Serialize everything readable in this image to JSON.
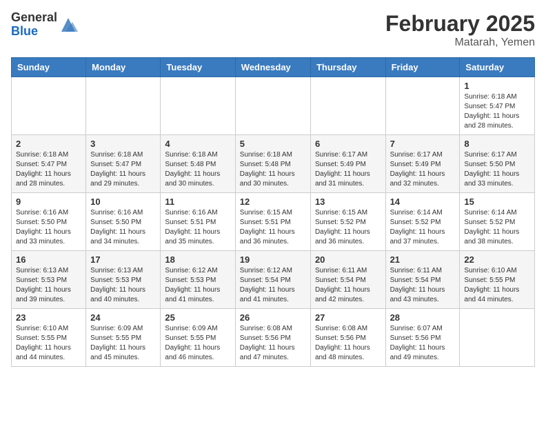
{
  "header": {
    "logo_general": "General",
    "logo_blue": "Blue",
    "month_title": "February 2025",
    "location": "Matarah, Yemen"
  },
  "days_of_week": [
    "Sunday",
    "Monday",
    "Tuesday",
    "Wednesday",
    "Thursday",
    "Friday",
    "Saturday"
  ],
  "weeks": [
    [
      {
        "day": "",
        "info": ""
      },
      {
        "day": "",
        "info": ""
      },
      {
        "day": "",
        "info": ""
      },
      {
        "day": "",
        "info": ""
      },
      {
        "day": "",
        "info": ""
      },
      {
        "day": "",
        "info": ""
      },
      {
        "day": "1",
        "info": "Sunrise: 6:18 AM\nSunset: 5:47 PM\nDaylight: 11 hours and 28 minutes."
      }
    ],
    [
      {
        "day": "2",
        "info": "Sunrise: 6:18 AM\nSunset: 5:47 PM\nDaylight: 11 hours and 28 minutes."
      },
      {
        "day": "3",
        "info": "Sunrise: 6:18 AM\nSunset: 5:47 PM\nDaylight: 11 hours and 29 minutes."
      },
      {
        "day": "4",
        "info": "Sunrise: 6:18 AM\nSunset: 5:48 PM\nDaylight: 11 hours and 30 minutes."
      },
      {
        "day": "5",
        "info": "Sunrise: 6:18 AM\nSunset: 5:48 PM\nDaylight: 11 hours and 30 minutes."
      },
      {
        "day": "6",
        "info": "Sunrise: 6:17 AM\nSunset: 5:49 PM\nDaylight: 11 hours and 31 minutes."
      },
      {
        "day": "7",
        "info": "Sunrise: 6:17 AM\nSunset: 5:49 PM\nDaylight: 11 hours and 32 minutes."
      },
      {
        "day": "8",
        "info": "Sunrise: 6:17 AM\nSunset: 5:50 PM\nDaylight: 11 hours and 33 minutes."
      }
    ],
    [
      {
        "day": "9",
        "info": "Sunrise: 6:16 AM\nSunset: 5:50 PM\nDaylight: 11 hours and 33 minutes."
      },
      {
        "day": "10",
        "info": "Sunrise: 6:16 AM\nSunset: 5:50 PM\nDaylight: 11 hours and 34 minutes."
      },
      {
        "day": "11",
        "info": "Sunrise: 6:16 AM\nSunset: 5:51 PM\nDaylight: 11 hours and 35 minutes."
      },
      {
        "day": "12",
        "info": "Sunrise: 6:15 AM\nSunset: 5:51 PM\nDaylight: 11 hours and 36 minutes."
      },
      {
        "day": "13",
        "info": "Sunrise: 6:15 AM\nSunset: 5:52 PM\nDaylight: 11 hours and 36 minutes."
      },
      {
        "day": "14",
        "info": "Sunrise: 6:14 AM\nSunset: 5:52 PM\nDaylight: 11 hours and 37 minutes."
      },
      {
        "day": "15",
        "info": "Sunrise: 6:14 AM\nSunset: 5:52 PM\nDaylight: 11 hours and 38 minutes."
      }
    ],
    [
      {
        "day": "16",
        "info": "Sunrise: 6:13 AM\nSunset: 5:53 PM\nDaylight: 11 hours and 39 minutes."
      },
      {
        "day": "17",
        "info": "Sunrise: 6:13 AM\nSunset: 5:53 PM\nDaylight: 11 hours and 40 minutes."
      },
      {
        "day": "18",
        "info": "Sunrise: 6:12 AM\nSunset: 5:53 PM\nDaylight: 11 hours and 41 minutes."
      },
      {
        "day": "19",
        "info": "Sunrise: 6:12 AM\nSunset: 5:54 PM\nDaylight: 11 hours and 41 minutes."
      },
      {
        "day": "20",
        "info": "Sunrise: 6:11 AM\nSunset: 5:54 PM\nDaylight: 11 hours and 42 minutes."
      },
      {
        "day": "21",
        "info": "Sunrise: 6:11 AM\nSunset: 5:54 PM\nDaylight: 11 hours and 43 minutes."
      },
      {
        "day": "22",
        "info": "Sunrise: 6:10 AM\nSunset: 5:55 PM\nDaylight: 11 hours and 44 minutes."
      }
    ],
    [
      {
        "day": "23",
        "info": "Sunrise: 6:10 AM\nSunset: 5:55 PM\nDaylight: 11 hours and 44 minutes."
      },
      {
        "day": "24",
        "info": "Sunrise: 6:09 AM\nSunset: 5:55 PM\nDaylight: 11 hours and 45 minutes."
      },
      {
        "day": "25",
        "info": "Sunrise: 6:09 AM\nSunset: 5:55 PM\nDaylight: 11 hours and 46 minutes."
      },
      {
        "day": "26",
        "info": "Sunrise: 6:08 AM\nSunset: 5:56 PM\nDaylight: 11 hours and 47 minutes."
      },
      {
        "day": "27",
        "info": "Sunrise: 6:08 AM\nSunset: 5:56 PM\nDaylight: 11 hours and 48 minutes."
      },
      {
        "day": "28",
        "info": "Sunrise: 6:07 AM\nSunset: 5:56 PM\nDaylight: 11 hours and 49 minutes."
      },
      {
        "day": "",
        "info": ""
      }
    ]
  ]
}
